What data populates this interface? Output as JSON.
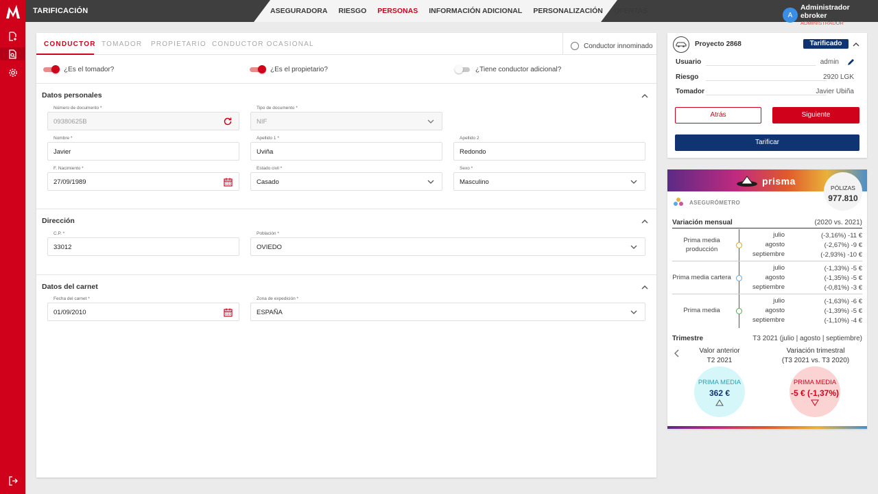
{
  "app": {
    "title": "TARIFICACIÓN"
  },
  "nav": [
    "ASEGURADORA",
    "RIESGO",
    "PERSONAS",
    "INFORMACIÓN ADICIONAL",
    "PERSONALIZACIÓN",
    "OFERTAS"
  ],
  "nav_active": "PERSONAS",
  "user": {
    "avatar_letter": "A",
    "name": "Administrador ebroker",
    "role": "ADMINISTRADOR"
  },
  "tabs": [
    "CONDUCTOR",
    "TOMADOR",
    "PROPIETARIO",
    "CONDUCTOR OCASIONAL"
  ],
  "conductor_innominado": "Conductor innominado",
  "toggles": {
    "tomador": {
      "label": "¿Es el tomador?",
      "on": true
    },
    "propietario": {
      "label": "¿Es el propietario?",
      "on": true
    },
    "adicional": {
      "label": "¿Tiene conductor adicional?",
      "on": false
    }
  },
  "sections": {
    "personales": "Datos personales",
    "direccion": "Dirección",
    "carnet": "Datos del carnet"
  },
  "fields": {
    "num_doc": {
      "label": "Número de documento *",
      "value": "09380625B"
    },
    "tipo_doc": {
      "label": "Tipo de documento *",
      "value": "NIF"
    },
    "nombre": {
      "label": "Nombre *",
      "value": "Javier"
    },
    "apellido1": {
      "label": "Apellido 1 *",
      "value": "Uviña"
    },
    "apellido2": {
      "label": "Apellido 2",
      "value": "Redondo"
    },
    "nacimiento": {
      "label": "F. Nacimiento *",
      "value": "27/09/1989"
    },
    "estado_civil": {
      "label": "Estado civil *",
      "value": "Casado"
    },
    "sexo": {
      "label": "Sexo *",
      "value": "Masculino"
    },
    "cp": {
      "label": "C.P. *",
      "value": "33012"
    },
    "poblacion": {
      "label": "Población *",
      "value": "OVIEDO"
    },
    "fecha_carnet": {
      "label": "Fecha del carnet *",
      "value": "01/09/2010"
    },
    "zona_expedicion": {
      "label": "Zona de expedición *",
      "value": "ESPAÑA"
    }
  },
  "project": {
    "title": "Proyecto 2868",
    "badge": "Tarificado",
    "rows": [
      {
        "key": "Usuario",
        "value": "admin"
      },
      {
        "key": "Riesgo",
        "value": "2920 LGK"
      },
      {
        "key": "Tomador",
        "value": "Javier Ubiña"
      }
    ],
    "btn_back": "Atrás",
    "btn_next": "Siguiente",
    "btn_tarificar": "Tarificar"
  },
  "prisma": {
    "brand": "prisma",
    "polizas_label": "PÓLIZAS",
    "polizas_value": "977.810",
    "asegurometro": "ASEGURÓMETRO",
    "variacion_title": "Variación mensual",
    "variacion_period": "(2020 vs. 2021)",
    "groups": [
      {
        "label": "Prima media producción",
        "months": [
          "julio",
          "agosto",
          "septiembre"
        ],
        "values": [
          "(-3,16%) -11 €",
          "(-2,67%) -9 €",
          "(-2,93%) -10 €"
        ],
        "dot_color": "#e0a800"
      },
      {
        "label": "Prima media cartera",
        "months": [
          "julio",
          "agosto",
          "septiembre"
        ],
        "values": [
          "(-1,33%) -5 €",
          "(-1,35%) -5 €",
          "(-0,81%) -3 €"
        ],
        "dot_color": "#5aa9e6"
      },
      {
        "label": "Prima media",
        "months": [
          "julio",
          "agosto",
          "septiembre"
        ],
        "values": [
          "(-1,63%) -6 €",
          "(-1,39%) -5 €",
          "(-1,10%) -4 €"
        ],
        "dot_color": "#4caf50"
      }
    ],
    "trimestre_title": "Trimestre",
    "trimestre_period": "T3 2021 (julio | agosto | septiembre)",
    "valor_anterior": "Valor anterior",
    "valor_anterior_period": "T2 2021",
    "variacion_trimestral": "Variación trimestral",
    "variacion_trimestral_period": "(T3 2021 vs. T3 2020)",
    "circle_left": {
      "label": "PRIMA MEDIA",
      "value": "362 €"
    },
    "circle_right": {
      "label": "PRIMA MEDIA",
      "value": "-5 € (-1,37%)"
    }
  },
  "colors": {
    "brand_red": "#d0021b",
    "navy": "#0f3471",
    "topbar": "#3f3f3f"
  }
}
